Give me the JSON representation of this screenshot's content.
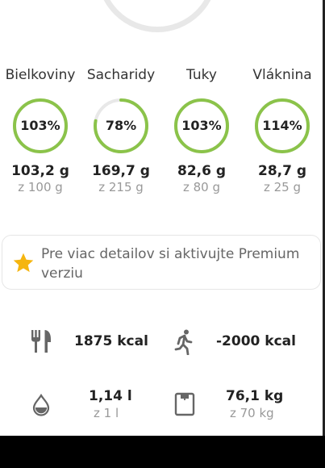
{
  "macros": [
    {
      "name": "Bielkoviny",
      "percent_label": "103%",
      "progress": 1.03,
      "value": "103,2 g",
      "goal": "z 100 g"
    },
    {
      "name": "Sacharidy",
      "percent_label": "78%",
      "progress": 0.78,
      "value": "169,7 g",
      "goal": "z 215 g"
    },
    {
      "name": "Tuky",
      "percent_label": "103%",
      "progress": 1.03,
      "value": "82,6 g",
      "goal": "z 80 g"
    },
    {
      "name": "Vláknina",
      "percent_label": "114%",
      "progress": 1.14,
      "value": "28,7 g",
      "goal": "z 25 g"
    }
  ],
  "premium_banner": {
    "text": "Pre viac detailov si aktivujte Premium verziu",
    "icon": "star-icon"
  },
  "stats": {
    "food": {
      "value": "1875 kcal",
      "icon": "fork-knife-icon"
    },
    "activity": {
      "value": "-2000 kcal",
      "icon": "walking-icon"
    },
    "water": {
      "value": "1,14 l",
      "goal": "z 1 l",
      "icon": "water-drop-icon"
    },
    "weight": {
      "value": "76,1 kg",
      "goal": "z 70 kg",
      "icon": "scale-icon"
    }
  },
  "colors": {
    "ring": "#8bc34a",
    "ring_track": "#e8e8e8",
    "star": "#f5b50f",
    "icon": "#666666"
  }
}
